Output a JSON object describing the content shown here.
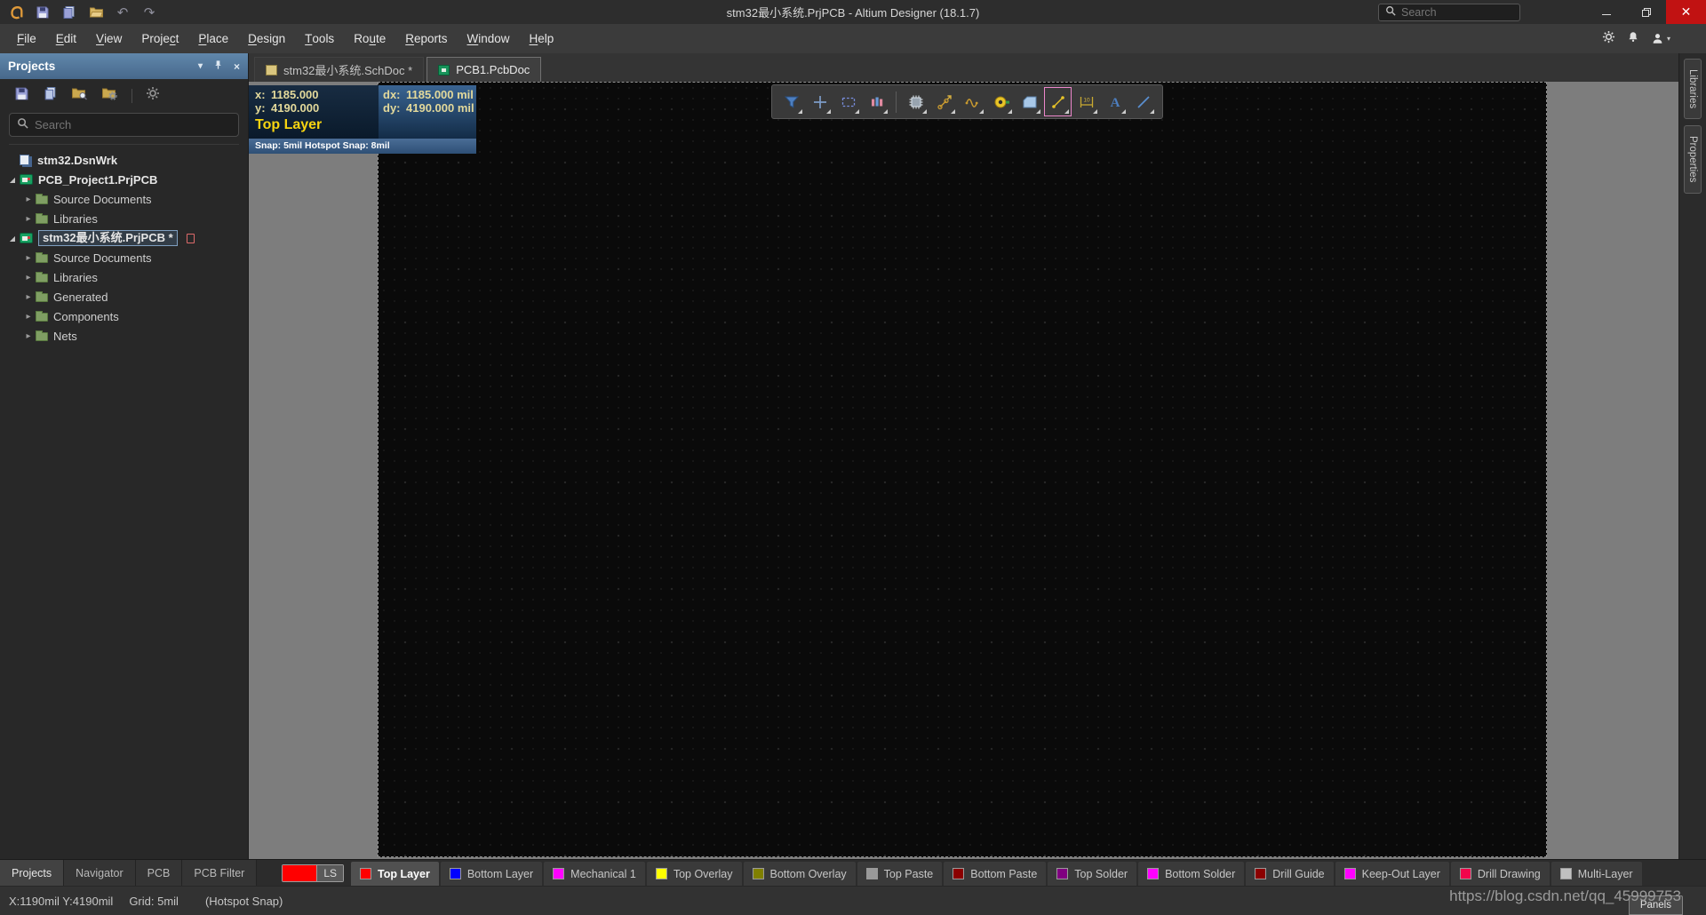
{
  "titlebar": {
    "title": "stm32最小系统.PrjPCB - Altium Designer (18.1.7)",
    "search_placeholder": "Search"
  },
  "menubar": {
    "items": [
      {
        "label": "File",
        "mnemonic": 0
      },
      {
        "label": "Edit",
        "mnemonic": 0
      },
      {
        "label": "View",
        "mnemonic": 0
      },
      {
        "label": "Project",
        "mnemonic": 5
      },
      {
        "label": "Place",
        "mnemonic": 0
      },
      {
        "label": "Design",
        "mnemonic": 0
      },
      {
        "label": "Tools",
        "mnemonic": 0
      },
      {
        "label": "Route",
        "mnemonic": 2
      },
      {
        "label": "Reports",
        "mnemonic": 0
      },
      {
        "label": "Window",
        "mnemonic": 0
      },
      {
        "label": "Help",
        "mnemonic": 0
      }
    ]
  },
  "projects_panel": {
    "title": "Projects",
    "search_placeholder": "Search",
    "tree": [
      {
        "label": "stm32.DsnWrk",
        "icon": "workspace",
        "level": 0,
        "arrow": "",
        "bold": true
      },
      {
        "label": "PCB_Project1.PrjPCB",
        "icon": "project",
        "level": 0,
        "arrow": "expanded",
        "bold": true
      },
      {
        "label": "Source Documents",
        "icon": "folder",
        "level": 1,
        "arrow": "collapsed",
        "bold": false
      },
      {
        "label": "Libraries",
        "icon": "folder",
        "level": 1,
        "arrow": "collapsed",
        "bold": false
      },
      {
        "label": "stm32最小系统.PrjPCB *",
        "icon": "project",
        "level": 0,
        "arrow": "expanded",
        "bold": true,
        "selected": true,
        "modified": true
      },
      {
        "label": "Source Documents",
        "icon": "folder",
        "level": 1,
        "arrow": "collapsed",
        "bold": false
      },
      {
        "label": "Libraries",
        "icon": "folder",
        "level": 1,
        "arrow": "collapsed",
        "bold": false
      },
      {
        "label": "Generated",
        "icon": "folder",
        "level": 1,
        "arrow": "collapsed",
        "bold": false
      },
      {
        "label": "Components",
        "icon": "folder",
        "level": 1,
        "arrow": "collapsed",
        "bold": false
      },
      {
        "label": "Nets",
        "icon": "folder",
        "level": 1,
        "arrow": "collapsed",
        "bold": false
      }
    ]
  },
  "doc_tabs": [
    {
      "label": "stm32最小系统.SchDoc *",
      "icon": "schematic",
      "active": false
    },
    {
      "label": "PCB1.PcbDoc",
      "icon": "pcb",
      "active": true
    }
  ],
  "hud": {
    "x_label": "x:",
    "x_value": "1185.000",
    "dx_label": "dx:",
    "dx_value": "1185.000 mil",
    "y_label": "y:",
    "y_value": "4190.000",
    "dy_label": "dy:",
    "dy_value": "4190.000 mil",
    "layer": "Top Layer",
    "snap": "Snap: 5mil Hotspot Snap: 8mil"
  },
  "active_bar": {
    "tools": [
      {
        "name": "filter"
      },
      {
        "name": "selection-cursor"
      },
      {
        "name": "select-area"
      },
      {
        "name": "pad-via-stack"
      },
      {
        "name": "separator"
      },
      {
        "name": "place-component"
      },
      {
        "name": "interactive-route"
      },
      {
        "name": "differential-pair-route"
      },
      {
        "name": "place-via"
      },
      {
        "name": "polygon-pour"
      },
      {
        "name": "measure",
        "highlighted": true
      },
      {
        "name": "dimension"
      },
      {
        "name": "place-string"
      },
      {
        "name": "place-line"
      }
    ]
  },
  "layer_bar": {
    "ls_label": "LS",
    "ls_color": "#ff0000",
    "layers": [
      {
        "label": "Top Layer",
        "color": "#ff0000",
        "active": true
      },
      {
        "label": "Bottom Layer",
        "color": "#0000ff"
      },
      {
        "label": "Mechanical 1",
        "color": "#ff00ff"
      },
      {
        "label": "Top Overlay",
        "color": "#ffff00"
      },
      {
        "label": "Bottom Overlay",
        "color": "#808000"
      },
      {
        "label": "Top Paste",
        "color": "#999999"
      },
      {
        "label": "Bottom Paste",
        "color": "#8b0000"
      },
      {
        "label": "Top Solder",
        "color": "#800080"
      },
      {
        "label": "Bottom Solder",
        "color": "#ff00ff"
      },
      {
        "label": "Drill Guide",
        "color": "#8b0000"
      },
      {
        "label": "Keep-Out Layer",
        "color": "#ff00ff"
      },
      {
        "label": "Drill Drawing",
        "color": "#f2054c"
      },
      {
        "label": "Multi-Layer",
        "color": "#c0c0c0"
      }
    ]
  },
  "panel_tabs": [
    {
      "label": "Projects",
      "active": true
    },
    {
      "label": "Navigator",
      "active": false
    },
    {
      "label": "PCB",
      "active": false
    },
    {
      "label": "PCB Filter",
      "active": false
    }
  ],
  "status_bar": {
    "coords": "X:1190mil Y:4190mil",
    "grid": "Grid: 5mil",
    "snap": "(Hotspot Snap)"
  },
  "right_tabs": [
    {
      "label": "Libraries"
    },
    {
      "label": "Properties"
    }
  ],
  "watermark": "https://blog.csdn.net/qq_45999753",
  "panels_button_label": "Panels"
}
